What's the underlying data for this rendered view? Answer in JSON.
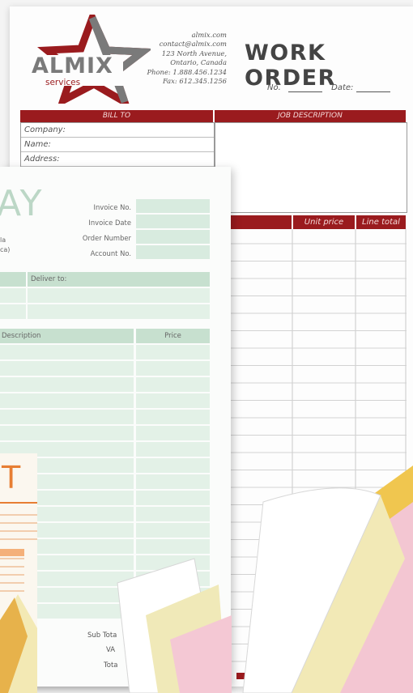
{
  "work_order": {
    "logo": {
      "name": "ALMIX",
      "tagline": "services"
    },
    "contact": [
      "almix.com",
      "contact@almix.com",
      "123 North Avenue,",
      "Ontario, Canada",
      "Phone: 1.888.456.1234",
      "Fax: 612.345.1256"
    ],
    "title": "WORK ORDER",
    "no_label": "No.",
    "date_label": "Date:",
    "bill_to": "BILL TO",
    "job_description": "JOB DESCRIPTION",
    "fields": [
      "Company:",
      "Name:",
      "Address:"
    ],
    "columns": [
      "Unit price",
      "Line total"
    ]
  },
  "invoice": {
    "big_title": "AY",
    "side_text": [
      "la",
      "ca)"
    ],
    "fields": [
      "Invoice No.",
      "Invoice Date",
      "Order Number",
      "Account No."
    ],
    "deliver_to": "Deliver to:",
    "columns": [
      "Description",
      "Price"
    ],
    "totals": [
      "Sub Tota",
      "VA",
      "Tota"
    ]
  },
  "receipt": {
    "big_title": "T"
  },
  "colors": {
    "red": "#9a1b1e",
    "green": "#c7e0cf",
    "pink": "#f3c6d2",
    "yellow": "#f2e9b6",
    "gold": "#e6b84a"
  }
}
